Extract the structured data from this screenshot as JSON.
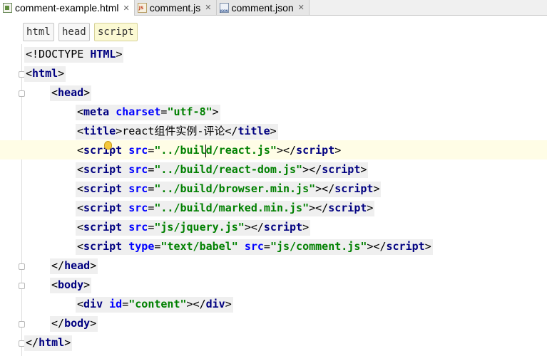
{
  "tabs": [
    {
      "label": "comment-example.html",
      "icon": "html-file-icon",
      "active": true
    },
    {
      "label": "comment.js",
      "icon": "js-file-icon",
      "active": false
    },
    {
      "label": "comment.json",
      "icon": "json-file-icon",
      "active": false
    }
  ],
  "tab_close_glyph": "✕",
  "breadcrumbs": [
    "html",
    "head",
    "script"
  ],
  "colors": {
    "tag": "#000080",
    "attribute": "#0000ff",
    "value": "#008000",
    "current_line": "#fffde6",
    "active_breadcrumb": "#fbf9d3"
  },
  "code": {
    "l1": [
      "<!DOCTYPE ",
      "HTML",
      ">"
    ],
    "l2": [
      "<",
      "html",
      ">"
    ],
    "l3": [
      "<",
      "head",
      ">"
    ],
    "l4": [
      "<",
      "meta",
      " ",
      "charset",
      "=",
      "\"utf-8\"",
      ">"
    ],
    "l5": [
      "<",
      "title",
      ">",
      "react组件实例-评论",
      "</",
      "title",
      ">"
    ],
    "l6": [
      "<",
      "script",
      " ",
      "src",
      "=",
      "\"../buil",
      "d/react.js\"",
      "></",
      "script",
      ">"
    ],
    "l7": [
      "<",
      "script",
      " ",
      "src",
      "=",
      "\"../build/react-dom.js\"",
      "></",
      "script",
      ">"
    ],
    "l8": [
      "<",
      "script",
      " ",
      "src",
      "=",
      "\"../build/browser.min.js\"",
      "></",
      "script",
      ">"
    ],
    "l9": [
      "<",
      "script",
      " ",
      "src",
      "=",
      "\"../build/marked.min.js\"",
      "></",
      "script",
      ">"
    ],
    "l10": [
      "<",
      "script",
      " ",
      "src",
      "=",
      "\"js/jquery.js\"",
      "></",
      "script",
      ">"
    ],
    "l11": [
      "<",
      "script",
      " ",
      "type",
      "=",
      "\"text/babel\"",
      " ",
      "src",
      "=",
      "\"js/comment.js\"",
      "></",
      "script",
      ">"
    ],
    "l12": [
      "</",
      "head",
      ">"
    ],
    "l13": [
      "<",
      "body",
      ">"
    ],
    "l14": [
      "<",
      "div",
      " ",
      "id",
      "=",
      "\"content\"",
      "></",
      "div",
      ">"
    ],
    "l15": [
      "</",
      "body",
      ">"
    ],
    "l16": [
      "</",
      "html",
      ">"
    ]
  }
}
